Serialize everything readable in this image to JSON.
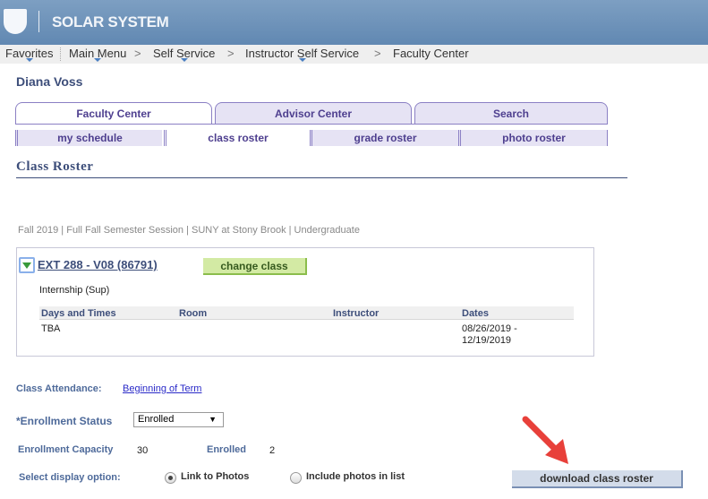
{
  "header": {
    "brand": "SOLAR SYSTEM"
  },
  "nav": {
    "items": [
      "Favorites",
      "Main Menu",
      "Self Service",
      "Instructor Self Service",
      "Faculty Center"
    ]
  },
  "user": {
    "name": "Diana Voss"
  },
  "tabs": [
    {
      "label": "Faculty Center",
      "active": true
    },
    {
      "label": "Advisor Center"
    },
    {
      "label": "Search"
    }
  ],
  "subtabs": [
    {
      "label": "my schedule"
    },
    {
      "label": "class roster",
      "active": true
    },
    {
      "label": "grade roster"
    },
    {
      "label": "photo roster"
    }
  ],
  "page": {
    "title": "Class Roster",
    "term": "Fall 2019 | Full Fall Semester Session | SUNY at Stony Brook | Undergraduate"
  },
  "class": {
    "link": "EXT 288 - V08 (86791)",
    "change_label": "change class",
    "component": "Internship (Sup)",
    "columns": [
      "Days and Times",
      "Room",
      "Instructor",
      "Dates"
    ],
    "row": {
      "days": "TBA",
      "room": "",
      "instructor": "",
      "dates1": "08/26/2019 -",
      "dates2": "12/19/2019"
    }
  },
  "attendance": {
    "label": "Class Attendance:",
    "value": "Beginning of Term"
  },
  "enrollment": {
    "status_label": "*Enrollment Status",
    "status_value": "Enrolled",
    "capacity_label": "Enrollment Capacity",
    "capacity": "30",
    "enrolled_label": "Enrolled",
    "enrolled": "2"
  },
  "display": {
    "label": "Select display option:",
    "options": [
      "Link to Photos",
      "Include photos in list"
    ],
    "selected": "Link to Photos"
  },
  "download_label": "download class roster",
  "colors": {
    "banner": "#6b8fb7",
    "annotation_arrow": "#e8403a"
  }
}
